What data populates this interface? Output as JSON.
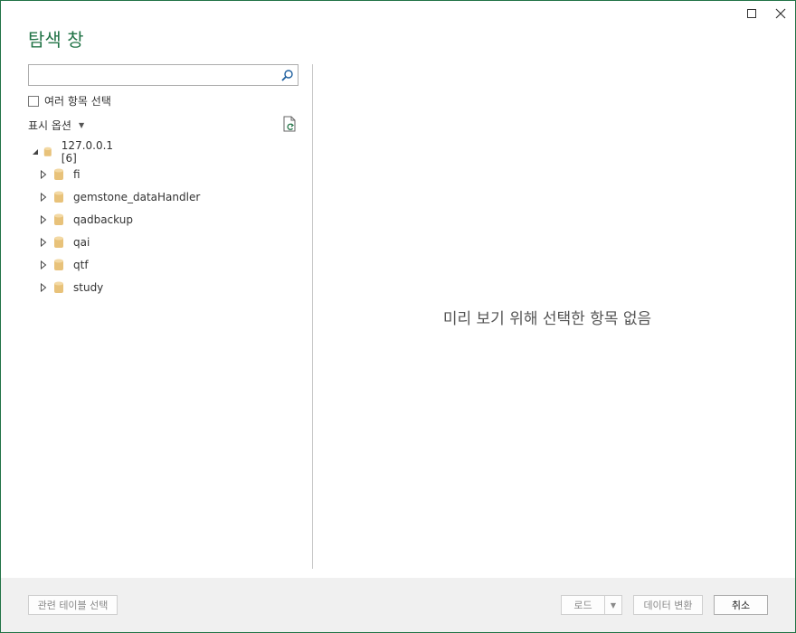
{
  "window": {
    "title": "탐색 창"
  },
  "search": {
    "value": "",
    "placeholder": ""
  },
  "multi_select": {
    "label": "여러 항목 선택",
    "checked": false
  },
  "display_options": {
    "label": "표시 옵션"
  },
  "tree": {
    "root": {
      "label": "127.0.0.1 [6]",
      "expanded": true
    },
    "children": [
      {
        "label": "fi"
      },
      {
        "label": "gemstone_dataHandler"
      },
      {
        "label": "qadbackup"
      },
      {
        "label": "qai"
      },
      {
        "label": "qtf"
      },
      {
        "label": "study"
      }
    ]
  },
  "preview": {
    "empty_message": "미리 보기 위해 선택한 항목 없음"
  },
  "footer": {
    "related_tables": "관련 테이블 선택",
    "load": "로드",
    "transform": "데이터 변환",
    "cancel": "취소"
  },
  "colors": {
    "accent": "#217346",
    "db_icon": "#e8c27a"
  }
}
